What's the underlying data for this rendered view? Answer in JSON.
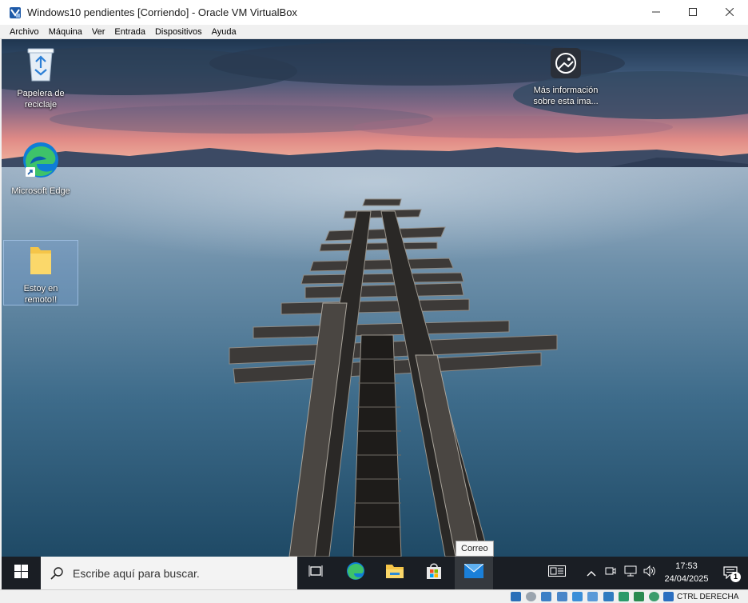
{
  "window": {
    "title": "Windows10 pendientes [Corriendo] - Oracle VM VirtualBox",
    "icon": "virtualbox-logo",
    "controls": [
      "minimize-icon",
      "maximize-icon",
      "close-icon"
    ]
  },
  "menu": [
    "Archivo",
    "Máquina",
    "Ver",
    "Entrada",
    "Dispositivos",
    "Ayuda"
  ],
  "desktop": {
    "icons": [
      {
        "label_1": "Papelera de",
        "label_2": "reciclaje",
        "icon": "recycle-bin-icon"
      },
      {
        "label_1": "Microsoft Edge",
        "label_2": "",
        "icon": "edge-icon"
      },
      {
        "label_1": "Estoy en",
        "label_2": "remoto!!",
        "icon": "folder-icon",
        "selected": true
      },
      {
        "label_1": "Más información",
        "label_2": "sobre esta ima...",
        "icon": "spotlight-camera-icon"
      }
    ]
  },
  "tooltip": {
    "text": "Correo"
  },
  "taskbar": {
    "search_placeholder": "Escribe aquí para buscar.",
    "apps": [
      "task-view-icon",
      "edge-icon",
      "file-explorer-icon",
      "microsoft-store-icon",
      "mail-icon"
    ],
    "active_app": "mail-icon",
    "clock": {
      "time": "17:53",
      "date": "24/04/2025"
    },
    "notification_count": "1",
    "tray": [
      "news-icon",
      "chevron-up-icon",
      "meet-icon",
      "network-icon",
      "volume-icon"
    ]
  },
  "statusbar": {
    "host_key": "CTRL DERECHA",
    "icons": [
      "hard-disk-icon",
      "optical-disk-icon",
      "audio-icon",
      "usb-icon",
      "shared-folders-icon",
      "display-icon",
      "network-adapter-icon",
      "recording-icon",
      "cpu-icon",
      "mouse-integration-icon",
      "keyboard-icon"
    ]
  },
  "colors": {
    "taskbar_bg": "#1a1e24",
    "accent": "#0078d4"
  }
}
